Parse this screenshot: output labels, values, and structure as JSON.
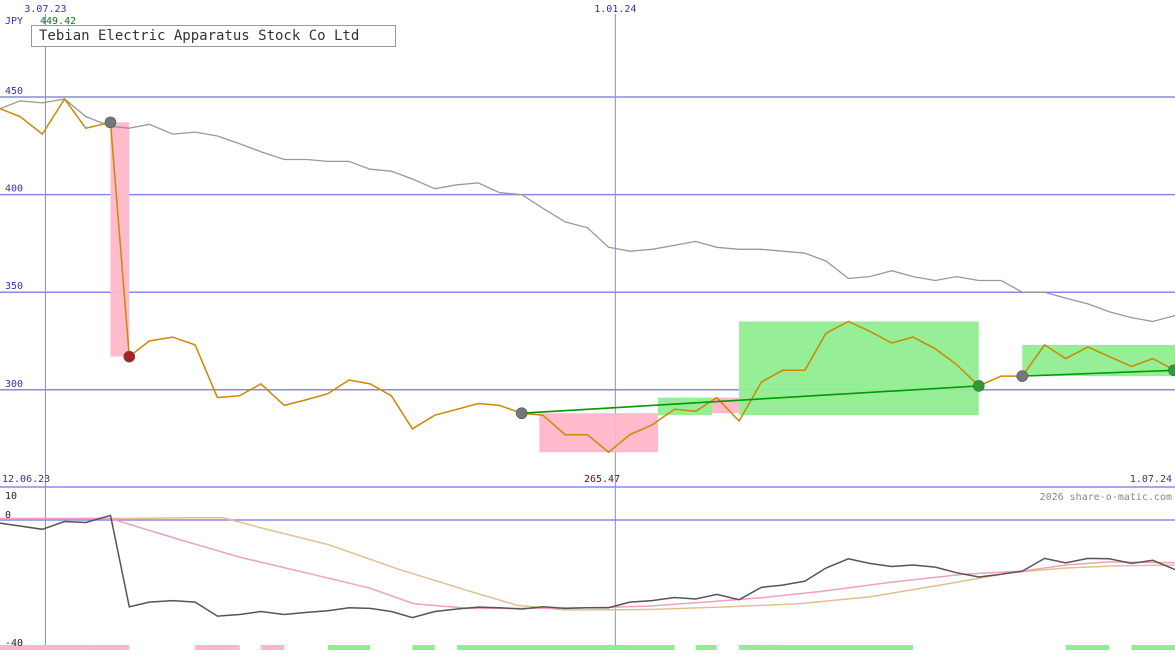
{
  "chart_data": [
    {
      "type": "line",
      "title": "Tebian Electric Apparatus Stock Co Ltd",
      "currency_label": "JPY",
      "ylim": [
        265,
        465
      ],
      "yticks": [
        {
          "value": 300,
          "label": "300"
        },
        {
          "value": 350,
          "label": "350"
        },
        {
          "value": 400,
          "label": "400"
        },
        {
          "value": 450,
          "label": "450"
        }
      ],
      "x_markers": [
        {
          "pos": 0.037,
          "label": "3.07.23"
        },
        {
          "pos": 0.522,
          "label": "1.01.24"
        }
      ],
      "corner_labels": {
        "left_bottom": "12.06.23",
        "right_bottom": "1.07.24",
        "center_bottom": "265.47",
        "top_value": "449.42"
      },
      "price": [
        [
          0.0,
          444
        ],
        [
          0.017,
          440
        ],
        [
          0.036,
          431
        ],
        [
          0.055,
          449
        ],
        [
          0.073,
          434
        ],
        [
          0.094,
          437
        ],
        [
          0.11,
          317
        ],
        [
          0.127,
          325
        ],
        [
          0.147,
          327
        ],
        [
          0.166,
          323
        ],
        [
          0.185,
          296
        ],
        [
          0.204,
          297
        ],
        [
          0.222,
          303
        ],
        [
          0.242,
          292
        ],
        [
          0.261,
          295
        ],
        [
          0.279,
          298
        ],
        [
          0.297,
          305
        ],
        [
          0.315,
          303
        ],
        [
          0.333,
          297
        ],
        [
          0.351,
          280
        ],
        [
          0.37,
          287
        ],
        [
          0.389,
          290
        ],
        [
          0.407,
          293
        ],
        [
          0.425,
          292
        ],
        [
          0.444,
          288
        ],
        [
          0.462,
          287
        ],
        [
          0.481,
          277
        ],
        [
          0.5,
          277
        ],
        [
          0.518,
          268
        ],
        [
          0.536,
          277
        ],
        [
          0.555,
          282
        ],
        [
          0.574,
          290
        ],
        [
          0.592,
          289
        ],
        [
          0.61,
          296
        ],
        [
          0.629,
          284
        ],
        [
          0.648,
          304
        ],
        [
          0.666,
          310
        ],
        [
          0.685,
          310
        ],
        [
          0.703,
          329
        ],
        [
          0.722,
          335
        ],
        [
          0.74,
          330
        ],
        [
          0.759,
          324
        ],
        [
          0.777,
          327
        ],
        [
          0.796,
          321
        ],
        [
          0.814,
          313
        ],
        [
          0.833,
          302
        ],
        [
          0.852,
          307
        ],
        [
          0.87,
          307
        ],
        [
          0.889,
          323
        ],
        [
          0.907,
          316
        ],
        [
          0.926,
          322
        ],
        [
          0.944,
          317
        ],
        [
          0.963,
          312
        ],
        [
          0.981,
          316
        ],
        [
          1.0,
          310
        ]
      ],
      "reference": [
        [
          0.0,
          444
        ],
        [
          0.017,
          448
        ],
        [
          0.036,
          447
        ],
        [
          0.055,
          449
        ],
        [
          0.073,
          440
        ],
        [
          0.094,
          435
        ],
        [
          0.11,
          434
        ],
        [
          0.127,
          436
        ],
        [
          0.147,
          431
        ],
        [
          0.166,
          432
        ],
        [
          0.185,
          430
        ],
        [
          0.204,
          426
        ],
        [
          0.222,
          422
        ],
        [
          0.242,
          418
        ],
        [
          0.261,
          418
        ],
        [
          0.279,
          417
        ],
        [
          0.297,
          417
        ],
        [
          0.315,
          413
        ],
        [
          0.333,
          412
        ],
        [
          0.351,
          408
        ],
        [
          0.37,
          403
        ],
        [
          0.389,
          405
        ],
        [
          0.407,
          406
        ],
        [
          0.425,
          401
        ],
        [
          0.444,
          400
        ],
        [
          0.462,
          393
        ],
        [
          0.481,
          386
        ],
        [
          0.5,
          383
        ],
        [
          0.518,
          373
        ],
        [
          0.536,
          371
        ],
        [
          0.555,
          372
        ],
        [
          0.574,
          374
        ],
        [
          0.592,
          376
        ],
        [
          0.61,
          373
        ],
        [
          0.629,
          372
        ],
        [
          0.648,
          372
        ],
        [
          0.666,
          371
        ],
        [
          0.685,
          370
        ],
        [
          0.703,
          366
        ],
        [
          0.722,
          357
        ],
        [
          0.74,
          358
        ],
        [
          0.759,
          361
        ],
        [
          0.777,
          358
        ],
        [
          0.796,
          356
        ],
        [
          0.814,
          358
        ],
        [
          0.833,
          356
        ],
        [
          0.852,
          356
        ],
        [
          0.87,
          350
        ],
        [
          0.889,
          350
        ],
        [
          0.907,
          347
        ],
        [
          0.926,
          344
        ],
        [
          0.944,
          340
        ],
        [
          0.963,
          337
        ],
        [
          0.981,
          335
        ],
        [
          1.0,
          338
        ]
      ],
      "trend_lines": [
        {
          "from": [
            0.444,
            288
          ],
          "to": [
            0.833,
            302
          ],
          "color": "#009900"
        },
        {
          "from": [
            0.87,
            307
          ],
          "to": [
            1.0,
            310
          ],
          "color": "#009900"
        }
      ],
      "fill_segments": [
        {
          "color": "#ffb6c8",
          "x0": 0.094,
          "x1": 0.11,
          "top": 437,
          "bottom": 317
        },
        {
          "color": "#ffb6c8",
          "x0": 0.459,
          "x1": 0.56,
          "top": 288,
          "bottom": 268
        },
        {
          "color": "#90ee90",
          "x0": 0.56,
          "x1": 0.606,
          "top": 296,
          "bottom": 287
        },
        {
          "color": "#ffb6c8",
          "x0": 0.606,
          "x1": 0.629,
          "top": 296,
          "bottom": 288
        },
        {
          "color": "#90ee90",
          "x0": 0.629,
          "x1": 0.833,
          "top": 335,
          "bottom": 287
        },
        {
          "color": "#90ee90",
          "x0": 0.87,
          "x1": 1.0,
          "top": 323,
          "bottom": 307
        }
      ],
      "markers": [
        {
          "x": 0.094,
          "y": 437,
          "color": "#777777"
        },
        {
          "x": 0.11,
          "y": 317,
          "color": "#aa2222"
        },
        {
          "x": 0.444,
          "y": 288,
          "color": "#777777"
        },
        {
          "x": 0.833,
          "y": 302,
          "color": "#339933"
        },
        {
          "x": 0.87,
          "y": 307,
          "color": "#777777"
        },
        {
          "x": 1.0,
          "y": 310,
          "color": "#339933"
        }
      ]
    },
    {
      "type": "line",
      "ylim": [
        -40,
        10
      ],
      "yticks": [
        {
          "value": 10,
          "label": "10"
        },
        {
          "value": 0,
          "label": "0"
        },
        {
          "value": -40,
          "label": "-40"
        }
      ],
      "copyright": "2026 share-o-matic.com",
      "momentum": [
        [
          0.0,
          -1
        ],
        [
          0.036,
          -3
        ],
        [
          0.055,
          -0.5
        ],
        [
          0.073,
          -0.8
        ],
        [
          0.094,
          1.5
        ],
        [
          0.11,
          -28
        ],
        [
          0.127,
          -26.5
        ],
        [
          0.147,
          -26
        ],
        [
          0.166,
          -26.5
        ],
        [
          0.185,
          -31
        ],
        [
          0.204,
          -30.5
        ],
        [
          0.222,
          -29.5
        ],
        [
          0.242,
          -30.5
        ],
        [
          0.261,
          -29.8
        ],
        [
          0.279,
          -29.3
        ],
        [
          0.297,
          -28.3
        ],
        [
          0.315,
          -28.5
        ],
        [
          0.333,
          -29.5
        ],
        [
          0.351,
          -31.5
        ],
        [
          0.37,
          -29.5
        ],
        [
          0.389,
          -28.7
        ],
        [
          0.407,
          -28.1
        ],
        [
          0.425,
          -28.3
        ],
        [
          0.444,
          -28.7
        ],
        [
          0.462,
          -28
        ],
        [
          0.481,
          -28.5
        ],
        [
          0.5,
          -28.3
        ],
        [
          0.518,
          -28.3
        ],
        [
          0.536,
          -26.5
        ],
        [
          0.555,
          -26
        ],
        [
          0.574,
          -25
        ],
        [
          0.592,
          -25.5
        ],
        [
          0.61,
          -24
        ],
        [
          0.629,
          -25.7
        ],
        [
          0.648,
          -21.7
        ],
        [
          0.666,
          -21
        ],
        [
          0.685,
          -19.7
        ],
        [
          0.703,
          -15.5
        ],
        [
          0.722,
          -12.5
        ],
        [
          0.74,
          -14
        ],
        [
          0.759,
          -15
        ],
        [
          0.777,
          -14.5
        ],
        [
          0.796,
          -15.2
        ],
        [
          0.814,
          -17
        ],
        [
          0.833,
          -18.4
        ],
        [
          0.852,
          -17.5
        ],
        [
          0.87,
          -16.5
        ],
        [
          0.889,
          -12.4
        ],
        [
          0.907,
          -13.8
        ],
        [
          0.926,
          -12.4
        ],
        [
          0.944,
          -12.5
        ],
        [
          0.963,
          -14
        ],
        [
          0.981,
          -13
        ],
        [
          1.0,
          -16
        ]
      ],
      "ma_fast": [
        [
          0.0,
          0.5
        ],
        [
          0.094,
          0.5
        ],
        [
          0.15,
          -6
        ],
        [
          0.204,
          -12
        ],
        [
          0.26,
          -17
        ],
        [
          0.315,
          -22
        ],
        [
          0.352,
          -27
        ],
        [
          0.4,
          -28.5
        ],
        [
          0.45,
          -28.5
        ],
        [
          0.5,
          -28.3
        ],
        [
          0.55,
          -27.8
        ],
        [
          0.6,
          -26.5
        ],
        [
          0.65,
          -25
        ],
        [
          0.7,
          -23
        ],
        [
          0.76,
          -20
        ],
        [
          0.82,
          -17.5
        ],
        [
          0.87,
          -16.5
        ],
        [
          0.907,
          -14.5
        ],
        [
          0.944,
          -13.5
        ],
        [
          1.0,
          -13.8
        ]
      ],
      "ma_slow": [
        [
          0.0,
          0.5
        ],
        [
          0.11,
          0.5
        ],
        [
          0.16,
          0.7
        ],
        [
          0.19,
          0.7
        ],
        [
          0.222,
          -2.5
        ],
        [
          0.28,
          -8
        ],
        [
          0.34,
          -16
        ],
        [
          0.4,
          -23
        ],
        [
          0.44,
          -27.5
        ],
        [
          0.48,
          -29
        ],
        [
          0.52,
          -29
        ],
        [
          0.56,
          -28.8
        ],
        [
          0.62,
          -28
        ],
        [
          0.68,
          -27
        ],
        [
          0.74,
          -24.8
        ],
        [
          0.8,
          -21
        ],
        [
          0.86,
          -17
        ],
        [
          0.907,
          -15.5
        ],
        [
          0.95,
          -14.8
        ],
        [
          1.0,
          -14.5
        ]
      ],
      "volume_bars": [
        [
          0.0,
          0.075,
          "#ffb6c8"
        ],
        [
          0.075,
          0.11,
          "#ffb6c8"
        ],
        [
          0.166,
          0.204,
          "#ffb6c8"
        ],
        [
          0.222,
          0.242,
          "#ffb6c8"
        ],
        [
          0.279,
          0.315,
          "#90ee90"
        ],
        [
          0.351,
          0.37,
          "#90ee90"
        ],
        [
          0.389,
          0.574,
          "#90ee90"
        ],
        [
          0.592,
          0.61,
          "#90ee90"
        ],
        [
          0.629,
          0.648,
          "#90ee90"
        ],
        [
          0.648,
          0.666,
          "#90ee90"
        ],
        [
          0.666,
          0.777,
          "#90ee90"
        ],
        [
          0.907,
          0.944,
          "#90ee90"
        ],
        [
          0.963,
          1.0,
          "#90ee90"
        ]
      ]
    }
  ]
}
